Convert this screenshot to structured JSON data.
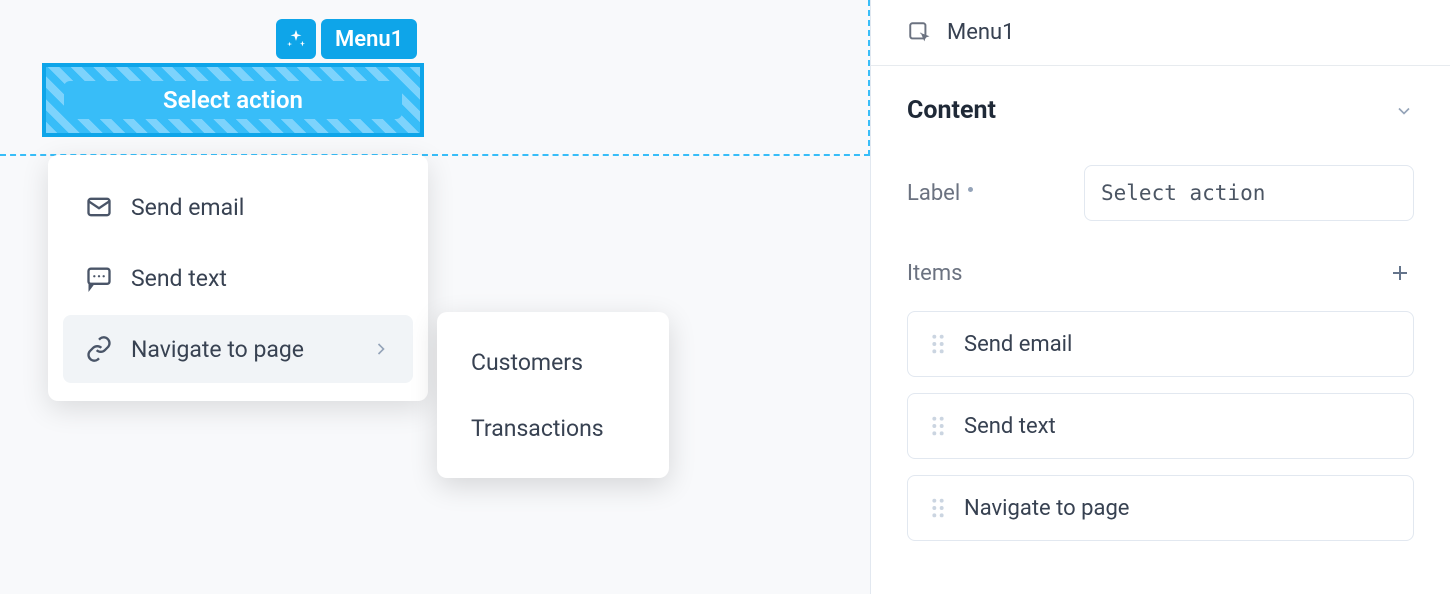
{
  "canvas": {
    "component_name": "Menu1",
    "button_label": "Select action",
    "menu_items": [
      {
        "label": "Send email",
        "icon": "mail-icon"
      },
      {
        "label": "Send text",
        "icon": "chat-icon"
      },
      {
        "label": "Navigate to page",
        "icon": "link-icon",
        "has_submenu": true
      }
    ],
    "submenu_items": [
      {
        "label": "Customers"
      },
      {
        "label": "Transactions"
      }
    ]
  },
  "inspector": {
    "header_title": "Menu1",
    "section_title": "Content",
    "label_field_name": "Label",
    "label_field_value": "Select action",
    "items_heading": "Items",
    "items": [
      {
        "label": "Send email"
      },
      {
        "label": "Send text"
      },
      {
        "label": "Navigate to page"
      }
    ]
  }
}
